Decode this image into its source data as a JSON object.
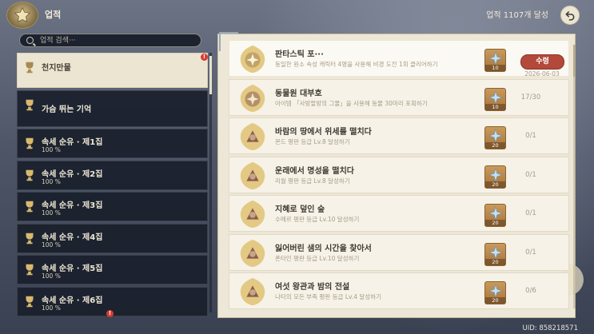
{
  "header": {
    "title": "업적",
    "achievement_count": "업적 1107개 달성"
  },
  "search": {
    "placeholder": "업적 검색···"
  },
  "categories": [
    {
      "name": "천지만물",
      "selected": true,
      "notification": "!"
    },
    {
      "name": "가슴 뛰는 기억"
    },
    {
      "name": "속세 순유 · 제1집",
      "percent": "100 %"
    },
    {
      "name": "속세 순유 · 제2집",
      "percent": "100 %"
    },
    {
      "name": "속세 순유 · 제3집",
      "percent": "100 %"
    },
    {
      "name": "속세 순유 · 제4집",
      "percent": "100 %"
    },
    {
      "name": "속세 순유 · 제5집",
      "percent": "100 %"
    },
    {
      "name": "속세 순유 · 제6집",
      "percent": "100 %",
      "notification": "!"
    }
  ],
  "achievements": [
    {
      "name": "판타스틱 포···",
      "desc": "동일한 원소 속성 캐릭터 4명을 사용해 비경 도전 1회 클리어하기",
      "reward": "10",
      "button": "수령",
      "date": "2026-06-03"
    },
    {
      "name": "동물원 대부호",
      "desc": "아이템 「사방팔방의 그물」을 사용해 동물 30마리 포획하기",
      "reward": "10",
      "progress": "17/30"
    },
    {
      "name": "바람의 땅에서 위세를 떨치다",
      "desc": "몬드 평판 등급 Lv.8 달성하기",
      "reward": "20",
      "progress": "0/1"
    },
    {
      "name": "운래에서 명성을 떨치다",
      "desc": "리월 평판 등급 Lv.8 달성하기",
      "reward": "20",
      "progress": "0/1"
    },
    {
      "name": "지혜로 덮인 숲",
      "desc": "수메르 평판 등급 Lv.10 달성하기",
      "reward": "20",
      "progress": "0/1"
    },
    {
      "name": "잃어버린 샘의 시간을 찾아서",
      "desc": "폰타인 평판 등급 Lv.10 달성하기",
      "reward": "20",
      "progress": "0/1"
    },
    {
      "name": "여섯 왕관과 밤의 전설",
      "desc": "나타의 모든 부족 평판 등급 Lv.4 달성하기",
      "reward": "20",
      "progress": "0/6"
    }
  ],
  "footer": {
    "uid": "UID: 858218571"
  },
  "colors": {
    "claim_button": "#b3493a",
    "panel": "#ede7d8",
    "category_dark": "#191f2b"
  }
}
